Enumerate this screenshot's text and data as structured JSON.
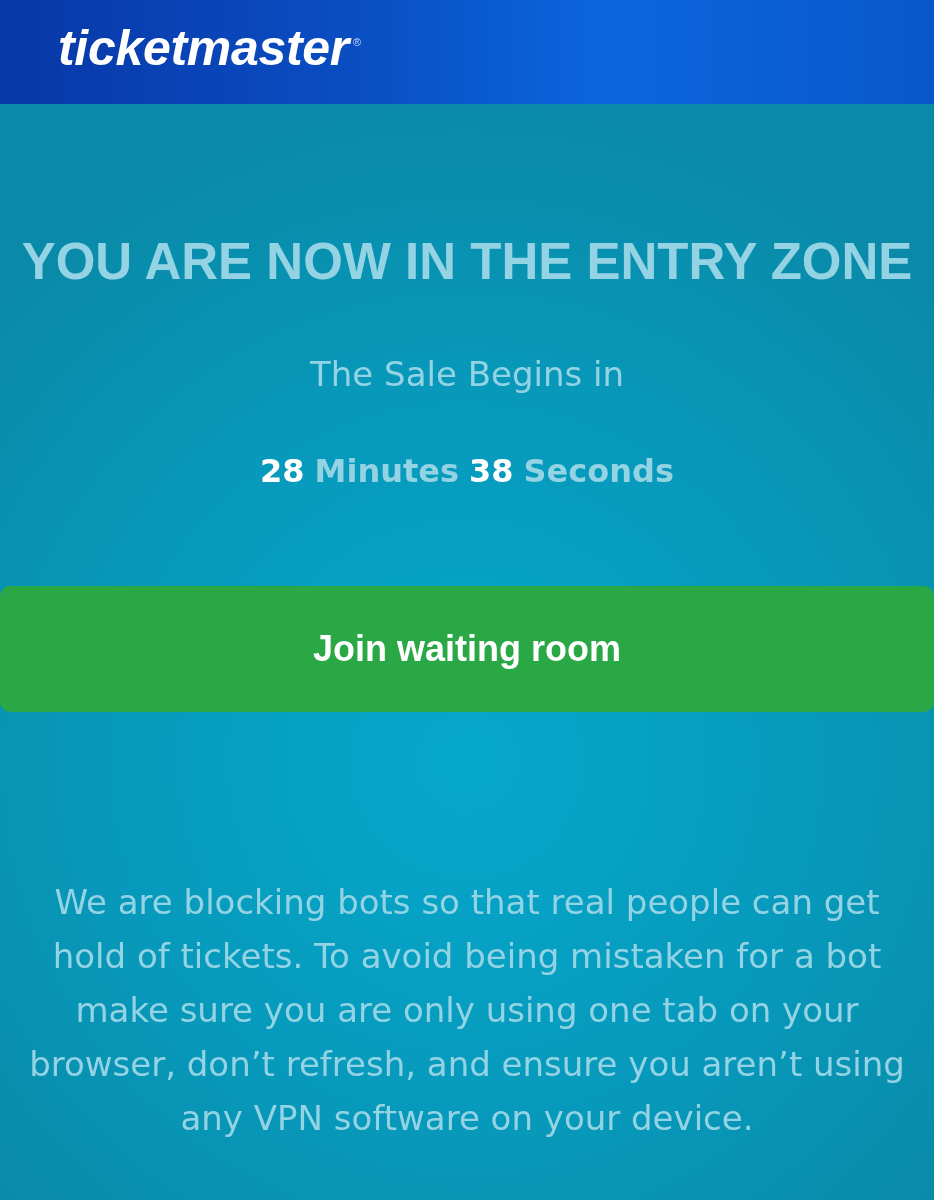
{
  "header": {
    "logo": {
      "name": "ticketmaster",
      "mark": "®"
    }
  },
  "title": "YOU ARE NOW IN THE ENTRY ZONE",
  "subtitle": "The Sale Begins in",
  "countdown": [
    {
      "kind": "value",
      "text": "28"
    },
    {
      "kind": "unit",
      "text": "Minutes"
    },
    {
      "kind": "value",
      "text": "38"
    },
    {
      "kind": "unit",
      "text": "Seconds"
    }
  ],
  "button": {
    "label": "Join waiting room"
  },
  "notice": "We are blocking bots so that real people can get hold of tickets. To avoid being mistaken for a bot make sure you are only using one tab on your browser, don’t refresh, and ensure you aren’t using any VPN software on your device."
}
